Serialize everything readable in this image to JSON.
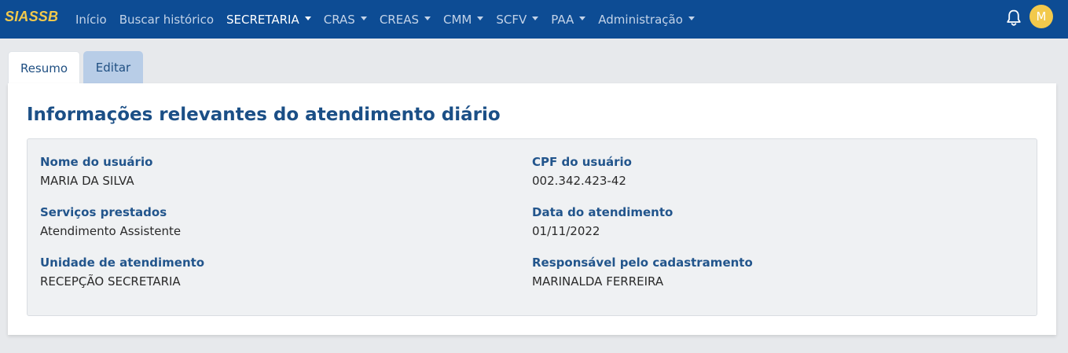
{
  "navbar": {
    "brand": "SIASSB",
    "items": [
      {
        "label": "Início",
        "dropdown": false,
        "active": false
      },
      {
        "label": "Buscar histórico",
        "dropdown": false,
        "active": false
      },
      {
        "label": "SECRETARIA",
        "dropdown": true,
        "active": true
      },
      {
        "label": "CRAS",
        "dropdown": true,
        "active": false
      },
      {
        "label": "CREAS",
        "dropdown": true,
        "active": false
      },
      {
        "label": "CMM",
        "dropdown": true,
        "active": false
      },
      {
        "label": "SCFV",
        "dropdown": true,
        "active": false
      },
      {
        "label": "PAA",
        "dropdown": true,
        "active": false
      },
      {
        "label": "Administração",
        "dropdown": true,
        "active": false
      }
    ],
    "notification_icon": "bell-icon",
    "avatar_initial": "M"
  },
  "tabs": [
    {
      "label": "Resumo",
      "active": true
    },
    {
      "label": "Editar",
      "active": false
    }
  ],
  "card": {
    "title": "Informações relevantes do atendimento diário",
    "fields": {
      "nome_label": "Nome do usuário",
      "nome_value": "MARIA DA SILVA",
      "cpf_label": "CPF do usuário",
      "cpf_value": "002.342.423-42",
      "servicos_label": "Serviços prestados",
      "servicos_value": "Atendimento Assistente",
      "data_label": "Data do atendimento",
      "data_value": "01/11/2022",
      "unidade_label": "Unidade de atendimento",
      "unidade_value": "RECEPÇÃO SECRETARIA",
      "responsavel_label": "Responsável pelo cadastramento",
      "responsavel_value": "MARINALDA FERREIRA"
    }
  },
  "colors": {
    "navbar_bg": "#0d4c94",
    "brand": "#f2c94c",
    "avatar_bg": "#f2c94c",
    "title": "#1b4f86",
    "tab_inactive_bg": "#b8cde7"
  }
}
